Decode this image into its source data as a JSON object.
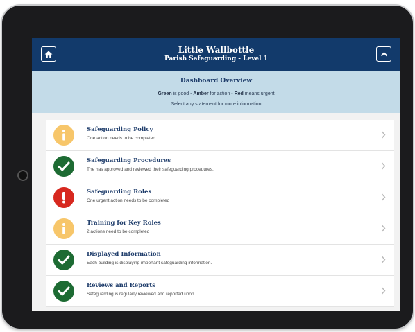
{
  "header": {
    "title": "Little Wallbottle",
    "subtitle": "Parish Safeguarding - Level 1",
    "home_icon": "home-icon",
    "collapse_icon": "chevron-up-icon"
  },
  "overview": {
    "title": "Dashboard Overview",
    "legend": {
      "green_word": "Green",
      "green_text": " is good - ",
      "amber_word": "Amber",
      "amber_text": " for action - ",
      "red_word": "Red",
      "red_text": " means urgent"
    },
    "hint": "Select any statement for more information"
  },
  "colors": {
    "header_bg": "#123a6b",
    "overview_bg": "#c3dbe8",
    "green": "#1d6b33",
    "amber": "#f7c66a",
    "red": "#d7281f"
  },
  "items": [
    {
      "title": "Safeguarding Policy",
      "desc": "One action needs to be completed",
      "status": "amber",
      "icon": "info-icon"
    },
    {
      "title": "Safeguarding Procedures",
      "desc": "The has approved and reviewed their safeguarding procedures.",
      "status": "green",
      "icon": "check-icon"
    },
    {
      "title": "Safeguarding Roles",
      "desc": "One urgent action needs to be completed",
      "status": "red",
      "icon": "exclamation-icon"
    },
    {
      "title": "Training for Key Roles",
      "desc": "2 actions need to be completed",
      "status": "amber",
      "icon": "info-icon"
    },
    {
      "title": "Displayed Information",
      "desc": "Each building is displaying important safeguarding information.",
      "status": "green",
      "icon": "check-icon"
    },
    {
      "title": "Reviews and Reports",
      "desc": "Safeguarding is regularly reviewed and reported upon.",
      "status": "green",
      "icon": "check-icon"
    }
  ]
}
